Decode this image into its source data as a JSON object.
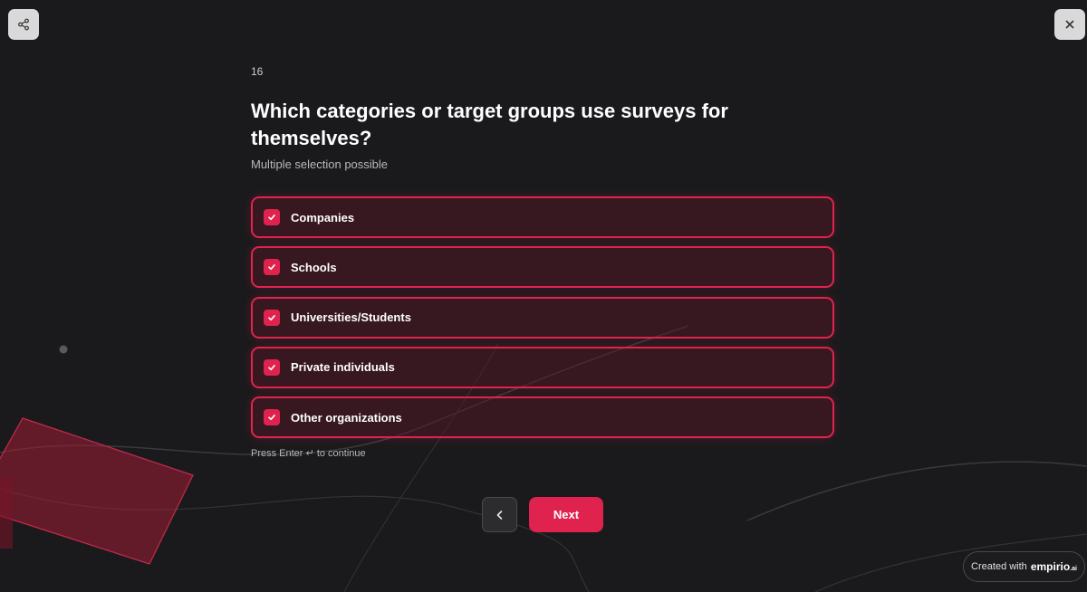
{
  "question": {
    "number": "16",
    "title": "Which categories or target groups use surveys for themselves?",
    "subtitle": "Multiple selection possible"
  },
  "options": [
    {
      "label": "Companies",
      "checked": true
    },
    {
      "label": "Schools",
      "checked": true
    },
    {
      "label": "Universities/Students",
      "checked": true
    },
    {
      "label": "Private individuals",
      "checked": true
    },
    {
      "label": "Other organizations",
      "checked": true
    }
  ],
  "hint": {
    "before": "Press Enter",
    "symbol": "↵",
    "after": "to continue"
  },
  "nav": {
    "next_label": "Next",
    "back_icon": "chevron-left-icon"
  },
  "badge": {
    "prefix": "Created with",
    "brand": "empirio",
    "brand_suffix": ".ai"
  },
  "colors": {
    "accent": "#e0234e",
    "background": "#1a1a1c"
  },
  "icons": {
    "share": "share-icon",
    "close": "close-icon",
    "check": "check-icon"
  }
}
